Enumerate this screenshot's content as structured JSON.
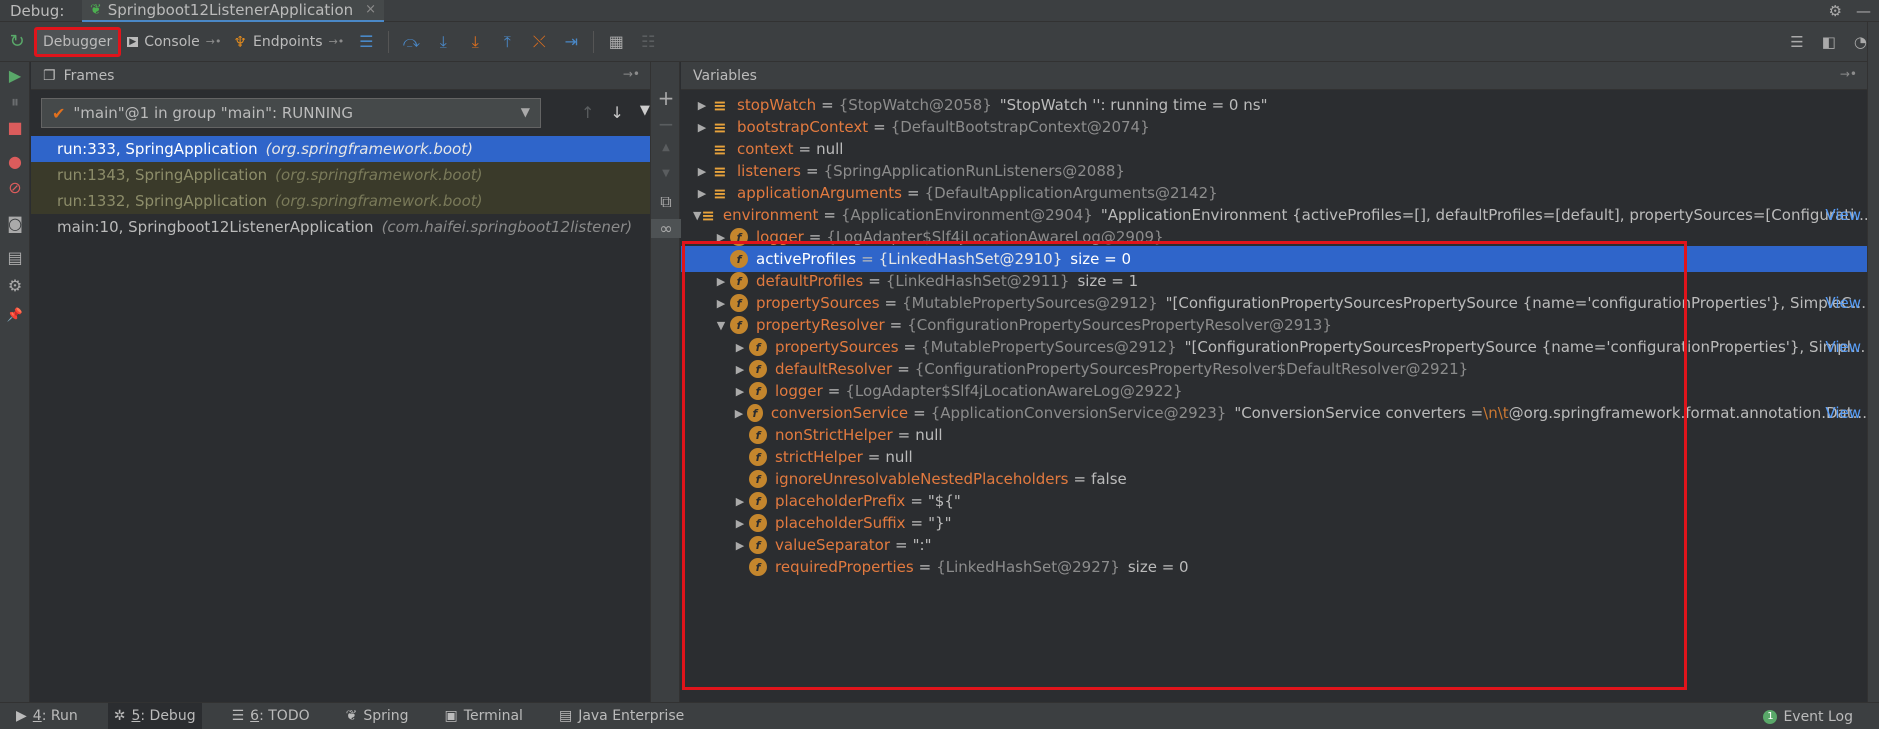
{
  "title_bar": {
    "debug_label": "Debug:",
    "run_tab_name": "Springboot12ListenerApplication",
    "close_glyph": "×",
    "settings_glyph": "⚙",
    "minimize_glyph": "—"
  },
  "toolbar": {
    "rerun_glyph": "↻",
    "debugger_label": "Debugger",
    "console_label": "Console",
    "endpoints_label": "Endpoints",
    "pin_glyph": "→•",
    "console_icon_glyph": "▶",
    "endpoints_icon_glyph": "♆",
    "buttons": {
      "show_exec_point": "☰",
      "step_over": "⤼",
      "step_into": "⤓",
      "force_step_into": "⤓",
      "step_out": "⤒",
      "drop_frame": "⤬",
      "run_to_cursor": "⇥",
      "evaluate": "▦",
      "trace": "☷"
    },
    "right": {
      "list": "☰",
      "layout": "◧",
      "gauge": "◔"
    }
  },
  "left_bar": {
    "resume": "▶",
    "pause": "⏸",
    "stop": "■",
    "breakpoints": "●",
    "mute": "⊘",
    "camera": "◙",
    "layout": "▤",
    "settings": "⚙",
    "pin": "📌"
  },
  "frames_panel": {
    "title": "Frames",
    "panel_icon": "❐",
    "pin_glyph": "→•",
    "thread_label": "\"main\"@1 in group \"main\": RUNNING",
    "check_glyph": "✔",
    "caret_glyph": "▼",
    "up_glyph": "↑",
    "down_glyph": "↓",
    "filter_glyph": "▼",
    "frames": [
      {
        "method": "run:333, SpringApplication",
        "package": "(org.springframework.boot)",
        "state": "selected"
      },
      {
        "method": "run:1343, SpringApplication",
        "package": "(org.springframework.boot)",
        "state": "library"
      },
      {
        "method": "run:1332, SpringApplication",
        "package": "(org.springframework.boot)",
        "state": "library"
      },
      {
        "method": "main:10, Springboot12ListenerApplication",
        "package": "(com.haifei.springboot12listener)",
        "state": "normal"
      }
    ]
  },
  "mid_bar": {
    "add": "+",
    "minus": "−",
    "up": "▲",
    "down": "▼",
    "copy": "⧉",
    "glasses": "∞"
  },
  "variables_panel": {
    "title": "Variables",
    "pin_glyph": "→•",
    "view_label": "View",
    "rows": [
      {
        "level": 0,
        "expand": "▶",
        "icon": "list",
        "name": "stopWatch",
        "type": "{StopWatch@2058}",
        "value": "\"StopWatch '': running time = 0 ns\"",
        "value_kind": "text"
      },
      {
        "level": 0,
        "expand": "▶",
        "icon": "list",
        "name": "bootstrapContext",
        "type": "{DefaultBootstrapContext@2074}",
        "value": "",
        "value_kind": "text"
      },
      {
        "level": 0,
        "expand": "",
        "icon": "list",
        "name": "context",
        "type": "",
        "value": "null",
        "value_kind": "plain"
      },
      {
        "level": 0,
        "expand": "▶",
        "icon": "list",
        "name": "listeners",
        "type": "{SpringApplicationRunListeners@2088}",
        "value": "",
        "value_kind": "text"
      },
      {
        "level": 0,
        "expand": "▶",
        "icon": "list",
        "name": "applicationArguments",
        "type": "{DefaultApplicationArguments@2142}",
        "value": "",
        "value_kind": "text"
      },
      {
        "level": 0,
        "expand": "▼",
        "icon": "list",
        "name": "environment",
        "type": "{ApplicationEnvironment@2904}",
        "value": "\"ApplicationEnvironment {activeProfiles=[], defaultProfiles=[default], propertySources=[Configurati...",
        "value_kind": "text",
        "view": true
      },
      {
        "level": 1,
        "expand": "▶",
        "icon": "field",
        "name": "logger",
        "type": "{LogAdapter$Slf4jLocationAwareLog@2909}",
        "value": "",
        "value_kind": "text"
      },
      {
        "level": 1,
        "expand": "",
        "icon": "field",
        "name": "activeProfiles",
        "type": "{LinkedHashSet@2910}",
        "value": "size = 0",
        "value_kind": "text",
        "selected": true
      },
      {
        "level": 1,
        "expand": "▶",
        "icon": "field",
        "name": "defaultProfiles",
        "type": "{LinkedHashSet@2911}",
        "value": "size = 1",
        "value_kind": "text"
      },
      {
        "level": 1,
        "expand": "▶",
        "icon": "field",
        "name": "propertySources",
        "type": "{MutablePropertySources@2912}",
        "value": "\"[ConfigurationPropertySourcesPropertySource {name='configurationProperties'}, SimpleC...",
        "value_kind": "text",
        "view": true
      },
      {
        "level": 1,
        "expand": "▼",
        "icon": "field",
        "name": "propertyResolver",
        "type": "{ConfigurationPropertySourcesPropertyResolver@2913}",
        "value": "",
        "value_kind": "text"
      },
      {
        "level": 2,
        "expand": "▶",
        "icon": "field",
        "name": "propertySources",
        "type": "{MutablePropertySources@2912}",
        "value": "\"[ConfigurationPropertySourcesPropertySource {name='configurationProperties'}, Simpl...",
        "value_kind": "text",
        "view": true
      },
      {
        "level": 2,
        "expand": "▶",
        "icon": "field",
        "name": "defaultResolver",
        "type": "{ConfigurationPropertySourcesPropertyResolver$DefaultResolver@2921}",
        "value": "",
        "value_kind": "text"
      },
      {
        "level": 2,
        "expand": "▶",
        "icon": "field",
        "name": "logger",
        "type": "{LogAdapter$Slf4jLocationAwareLog@2922}",
        "value": "",
        "value_kind": "text"
      },
      {
        "level": 2,
        "expand": "▶",
        "icon": "field",
        "name": "conversionService",
        "type": "{ApplicationConversionService@2923}",
        "value": "\"ConversionService converters =",
        "value_kind": "text",
        "escape": "\\n\\t",
        "tail": "@org.springframework.format.annotation.Dat...",
        "view": true
      },
      {
        "level": 2,
        "expand": "",
        "icon": "field",
        "name": "nonStrictHelper",
        "type": "",
        "value": "null",
        "value_kind": "plain"
      },
      {
        "level": 2,
        "expand": "",
        "icon": "field",
        "name": "strictHelper",
        "type": "",
        "value": "null",
        "value_kind": "plain"
      },
      {
        "level": 2,
        "expand": "",
        "icon": "field",
        "name": "ignoreUnresolvableNestedPlaceholders",
        "type": "",
        "value": "false",
        "value_kind": "plain"
      },
      {
        "level": 2,
        "expand": "▶",
        "icon": "field",
        "name": "placeholderPrefix",
        "type": "",
        "value": "\"${\"",
        "value_kind": "string"
      },
      {
        "level": 2,
        "expand": "▶",
        "icon": "field",
        "name": "placeholderSuffix",
        "type": "",
        "value": "\"}\"",
        "value_kind": "string"
      },
      {
        "level": 2,
        "expand": "▶",
        "icon": "field",
        "name": "valueSeparator",
        "type": "",
        "value": "\":\"",
        "value_kind": "string"
      },
      {
        "level": 2,
        "expand": "",
        "icon": "field",
        "name": "requiredProperties",
        "type": "{LinkedHashSet@2927}",
        "value": "size = 0",
        "value_kind": "text"
      }
    ]
  },
  "status_bar": {
    "items": [
      {
        "icon": "▶",
        "mnemonic": "4",
        "label": ": Run",
        "active": false
      },
      {
        "icon": "✲",
        "mnemonic": "5",
        "label": ": Debug",
        "active": true
      },
      {
        "icon": "☰",
        "mnemonic": "6",
        "label": ": TODO",
        "active": false
      },
      {
        "icon": "❦",
        "mnemonic": "",
        "label": "Spring",
        "active": false
      },
      {
        "icon": "▣",
        "mnemonic": "",
        "label": "Terminal",
        "active": false
      },
      {
        "icon": "▤",
        "mnemonic": "",
        "label": "Java Enterprise",
        "active": false
      }
    ],
    "event_log_count": "1",
    "event_log_label": "Event Log"
  },
  "colors": {
    "accent_blue": "#2f65ca",
    "highlight_red": "#e0141b",
    "var_name_orange": "#e27a3f",
    "field_icon": "#c4862d"
  }
}
